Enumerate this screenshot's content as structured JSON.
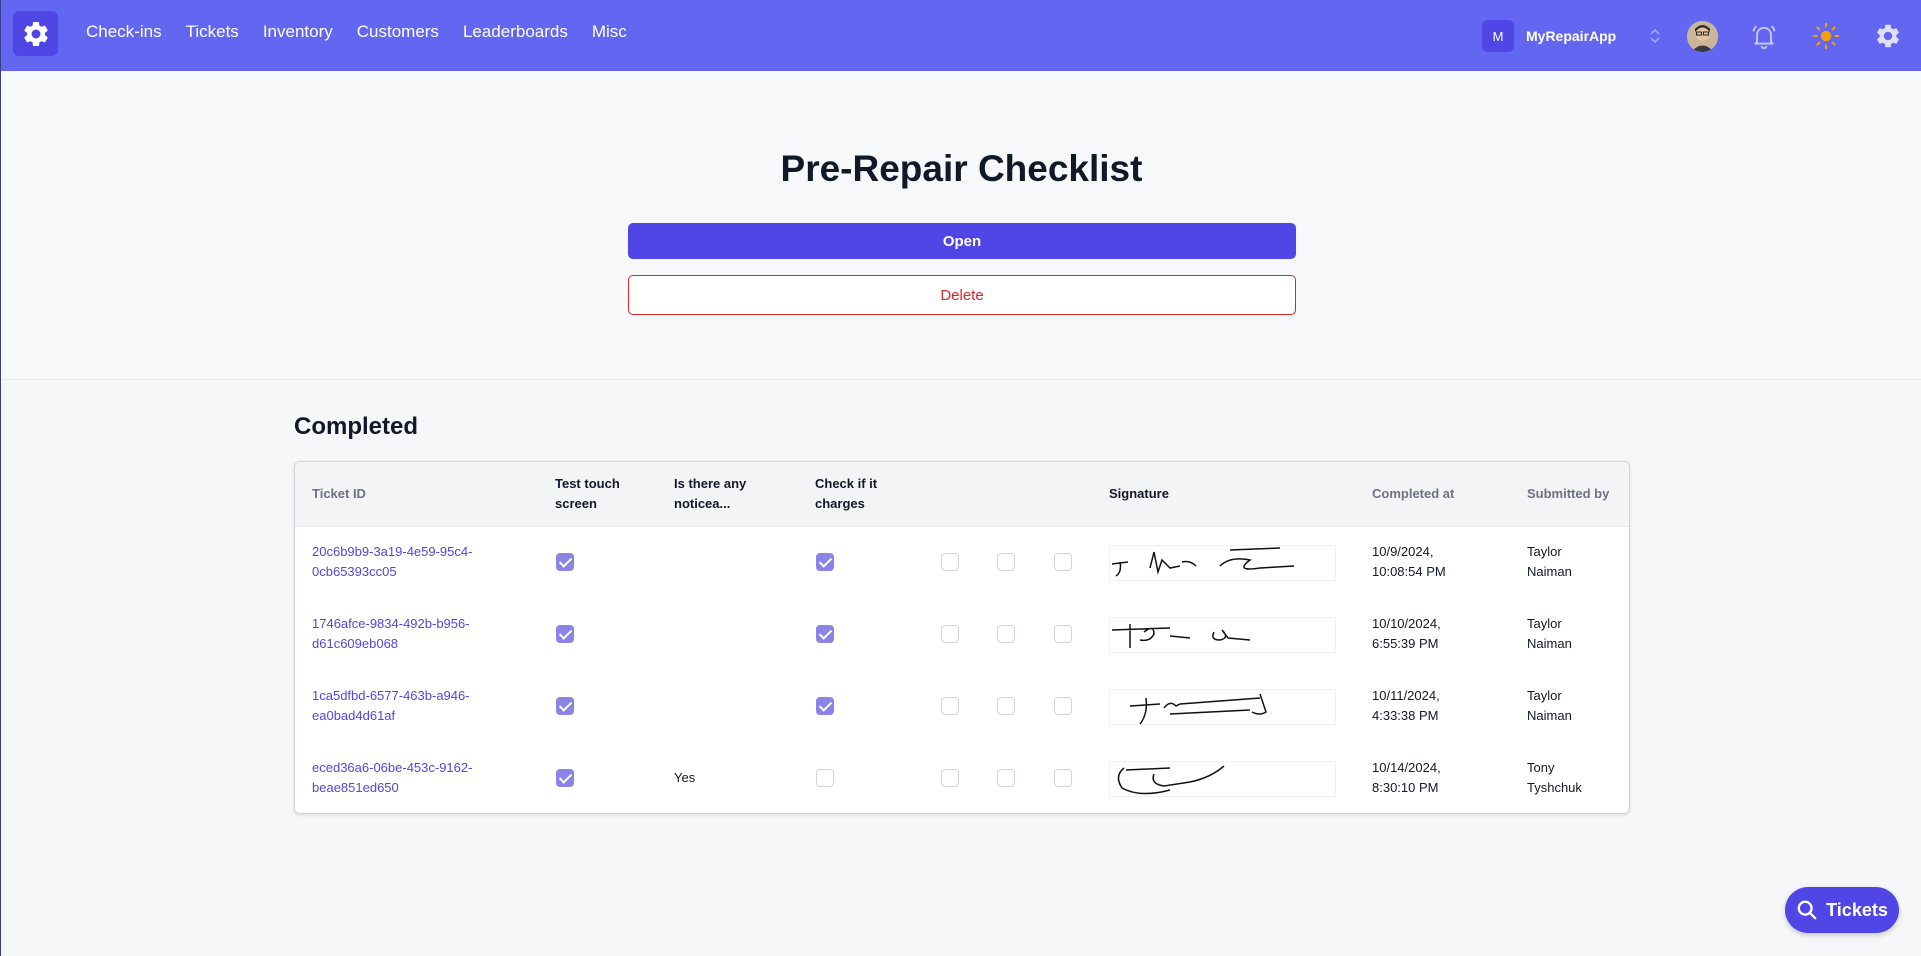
{
  "nav": {
    "items": [
      "Check-ins",
      "Tickets",
      "Inventory",
      "Customers",
      "Leaderboards",
      "Misc"
    ],
    "org_initial": "M",
    "org_name": "MyRepairApp"
  },
  "page": {
    "title": "Pre-Repair Checklist",
    "open_label": "Open",
    "delete_label": "Delete"
  },
  "completed": {
    "title": "Completed",
    "headers": {
      "ticket_id": "Ticket ID",
      "touch_line1": "Test touch",
      "touch_line2": "screen",
      "noticeable_line1": "Is there any",
      "noticeable_line2": "noticea...",
      "charges_line1": "Check if it",
      "charges_line2": "charges",
      "signature": "Signature",
      "completed_at": "Completed at",
      "submitted_by": "Submitted by"
    },
    "rows": [
      {
        "id_line1": "20c6b9b9-3a19-4e59-95c4-",
        "id_line2": "0cb65393cc05",
        "touch": true,
        "noticeable": "",
        "charges": true,
        "date_line1": "10/9/2024,",
        "date_line2": "10:08:54 PM",
        "by_line1": "Taylor",
        "by_line2": "Naiman"
      },
      {
        "id_line1": "1746afce-9834-492b-b956-",
        "id_line2": "d61c609eb068",
        "touch": true,
        "noticeable": "",
        "charges": true,
        "date_line1": "10/10/2024,",
        "date_line2": "6:55:39 PM",
        "by_line1": "Taylor",
        "by_line2": "Naiman"
      },
      {
        "id_line1": "1ca5dfbd-6577-463b-a946-",
        "id_line2": "ea0bad4d61af",
        "touch": true,
        "noticeable": "",
        "charges": true,
        "date_line1": "10/11/2024,",
        "date_line2": "4:33:38 PM",
        "by_line1": "Taylor",
        "by_line2": "Naiman"
      },
      {
        "id_line1": "eced36a6-06be-453c-9162-",
        "id_line2": "beae851ed650",
        "touch": true,
        "noticeable": "Yes",
        "charges": false,
        "date_line1": "10/14/2024,",
        "date_line2": "8:30:10 PM",
        "by_line1": "Tony",
        "by_line2": "Tyshchuk"
      }
    ]
  },
  "fab": {
    "label": "Tickets"
  },
  "colors": {
    "primary": "#6366f1",
    "accent": "#4f46e5",
    "danger": "#dc2626"
  }
}
